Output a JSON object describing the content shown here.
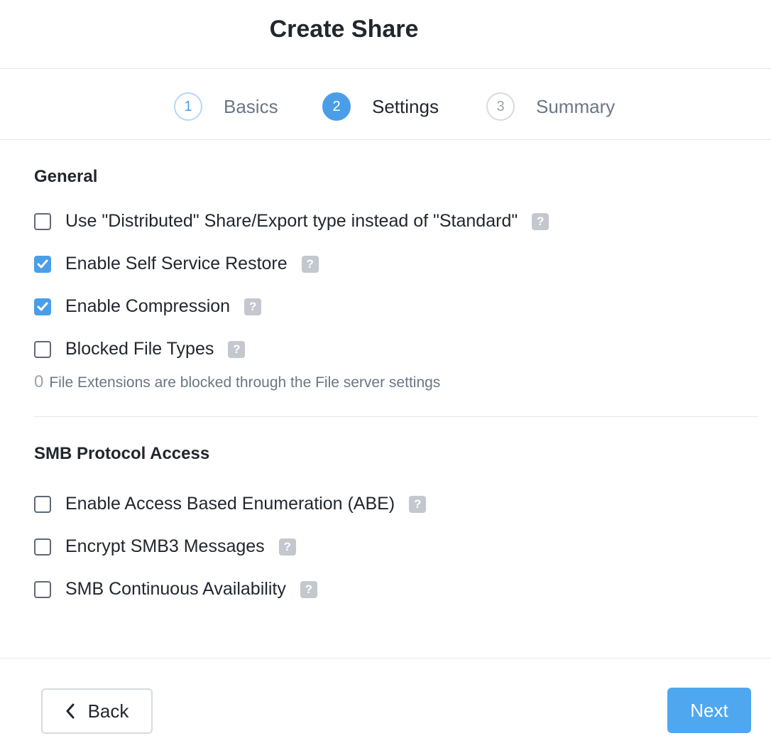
{
  "dialog": {
    "title": "Create Share"
  },
  "stepper": {
    "steps": [
      {
        "number": "1",
        "label": "Basics",
        "state": "completed"
      },
      {
        "number": "2",
        "label": "Settings",
        "state": "active"
      },
      {
        "number": "3",
        "label": "Summary",
        "state": "upcoming"
      }
    ]
  },
  "general": {
    "title": "General",
    "options": [
      {
        "label": "Use \"Distributed\" Share/Export type instead of \"Standard\"",
        "checked": false
      },
      {
        "label": "Enable Self Service Restore",
        "checked": true
      },
      {
        "label": "Enable Compression",
        "checked": true
      },
      {
        "label": "Blocked File Types",
        "checked": false
      }
    ],
    "hint_count": "0",
    "hint_text": "File Extensions are blocked through the File server settings"
  },
  "smb": {
    "title": "SMB Protocol Access",
    "options": [
      {
        "label": "Enable Access Based Enumeration (ABE)",
        "checked": false
      },
      {
        "label": "Encrypt SMB3 Messages",
        "checked": false
      },
      {
        "label": "SMB Continuous Availability",
        "checked": false
      }
    ]
  },
  "help_glyph": "?",
  "footer": {
    "back_label": "Back",
    "next_label": "Next"
  },
  "colors": {
    "accent": "#4a9ee8",
    "next_button": "#4fa7ef",
    "help_badge": "#c3c8ce",
    "divider": "#e6e8eb",
    "text": "#22272e",
    "muted_text": "#6b7684"
  },
  "icons": {
    "checkmark": "check-icon",
    "help": "help-icon",
    "back": "chevron-left-icon"
  }
}
